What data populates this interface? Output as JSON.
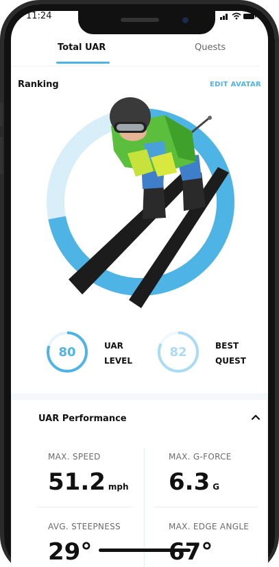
{
  "status": {
    "time": "11:24",
    "icons": "▮▮▮ ◠ ▬"
  },
  "tabs": {
    "active": "Total UAR",
    "inactive": "Quests"
  },
  "ranking": {
    "title": "Ranking",
    "edit_avatar": "EDIT AVATAR"
  },
  "avatar": {
    "ring_progress": 0.72
  },
  "stats": {
    "uar_level": {
      "value": "80",
      "label_line1": "UAR",
      "label_line2": "LEVEL",
      "color": "#4eb3e5"
    },
    "best_quest": {
      "value": "82",
      "label_line1": "BEST",
      "label_line2": "QUEST",
      "color": "#a9dcf4"
    }
  },
  "performance": {
    "title": "UAR Performance",
    "metrics": [
      {
        "label": "MAX. SPEED",
        "value": "51.2",
        "unit": "mph"
      },
      {
        "label": "MAX. G-FORCE",
        "value": "6.3",
        "unit": "G"
      },
      {
        "label": "AVG. STEEPNESS",
        "value": "29°",
        "unit": ""
      },
      {
        "label": "MAX. EDGE ANGLE",
        "value": "67°",
        "unit": ""
      }
    ]
  },
  "colors": {
    "accent": "#4eb3e5",
    "accent_light": "#a9dcf4",
    "text": "#111111"
  }
}
